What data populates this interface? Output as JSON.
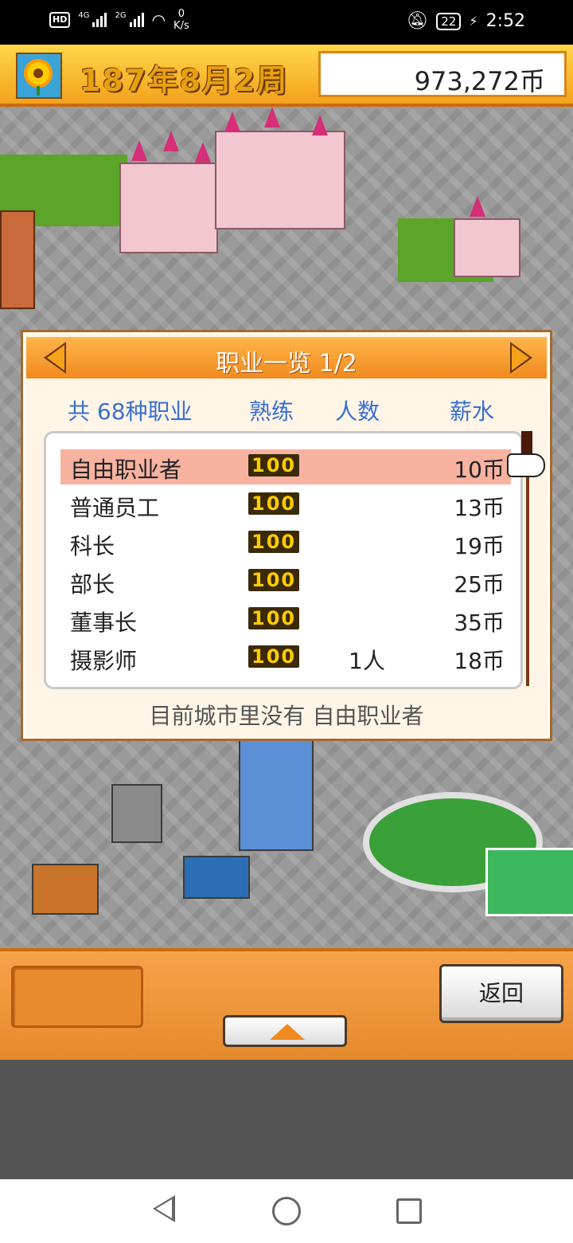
{
  "status_bar": {
    "hd": "HD",
    "sig1": "4G",
    "sig2": "2G",
    "speed_value": "0",
    "speed_unit": "K/s",
    "battery": "22",
    "time": "2:52"
  },
  "top_bar": {
    "date": "187年8月2周",
    "money": "973,272币"
  },
  "dialog": {
    "title": "职业一览 1/2",
    "columns": {
      "total": "共 68种职业",
      "skill": "熟练",
      "count": "人数",
      "salary": "薪水"
    },
    "rows": [
      {
        "name": "自由职业者",
        "skill": "100",
        "count": "",
        "salary": "10币",
        "selected": true
      },
      {
        "name": "普通员工",
        "skill": "100",
        "count": "",
        "salary": "13币"
      },
      {
        "name": "科长",
        "skill": "100",
        "count": "",
        "salary": "19币"
      },
      {
        "name": "部长",
        "skill": "100",
        "count": "",
        "salary": "25币"
      },
      {
        "name": "董事长",
        "skill": "100",
        "count": "",
        "salary": "35币"
      },
      {
        "name": "摄影师",
        "skill": "100",
        "count": "1人",
        "salary": "18币"
      }
    ],
    "message": "目前城市里没有 自由职业者"
  },
  "bottom": {
    "back_label": "返回"
  },
  "colors": {
    "accent_orange": "#f08a1e",
    "header_blue": "#3a6fcf",
    "selected_row": "#f7b2a0"
  }
}
